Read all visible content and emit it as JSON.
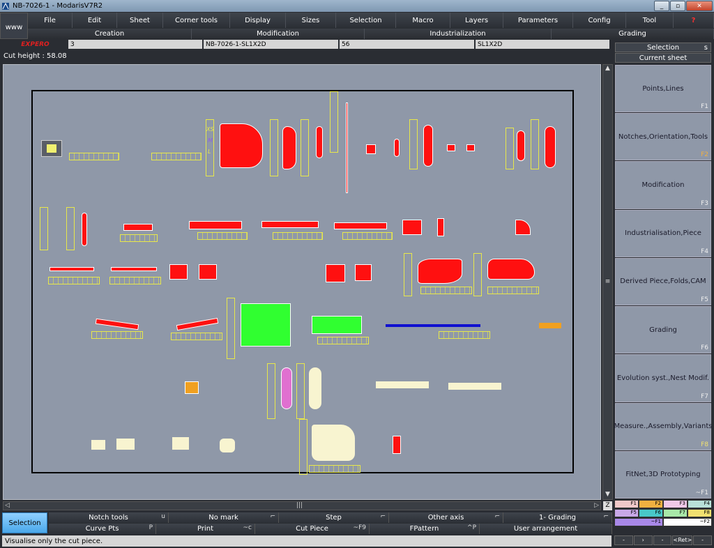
{
  "window": {
    "title": "NB-7026-1  - ModarisV7R2",
    "buttons": [
      "_",
      "▫",
      "✕"
    ]
  },
  "www": "www",
  "menu": [
    "File",
    "Edit",
    "Sheet",
    "Corner tools",
    "Display",
    "Sizes",
    "Selection",
    "Macro",
    "Layers",
    "Parameters",
    "Config",
    "Tool",
    "?"
  ],
  "categories": [
    "Creation",
    "Modification",
    "Industrialization",
    "Grading"
  ],
  "info": {
    "logo": "EXPERO",
    "field1": "3",
    "field2": "NB-7026-1-SL1X2D",
    "field3": "56",
    "field4": "SL1X2D"
  },
  "cut_height": "Cut height : 58.08",
  "right": {
    "selection": "Selection",
    "selection_key": "s",
    "current_sheet": "Current sheet",
    "panels": [
      {
        "label": "Points,Lines",
        "key": "F1"
      },
      {
        "label": "Notches,Orientation,Tools",
        "key": "F2"
      },
      {
        "label": "Modification",
        "key": "F3"
      },
      {
        "label": "Industrialisation,Piece",
        "key": "F4"
      },
      {
        "label": "Derived Piece,Folds,CAM",
        "key": "F5"
      },
      {
        "label": "Grading",
        "key": "F6"
      },
      {
        "label": "Evolution syst.,Nest Modif.",
        "key": "F7"
      },
      {
        "label": "Measure.,Assembly,Variants",
        "key": "F8"
      },
      {
        "label": "FitNet,3D Prototyping",
        "key": "~F1"
      }
    ],
    "fkeys_row1": [
      "F1",
      "F2",
      "F3",
      "F4"
    ],
    "fkeys_row2": [
      "F5",
      "F6",
      "F7",
      "F8"
    ],
    "fkeys_row3": [
      "~F1",
      "~F2"
    ],
    "nav": [
      "-",
      "›",
      "-",
      "<Ret>",
      "-"
    ]
  },
  "colors": {
    "row1": [
      "#f0c8c8",
      "#f0b040",
      "#f0c8e8",
      "#b8e0d8"
    ],
    "row2": [
      "#c8a8e8",
      "#48c8c8",
      "#a8e8a8",
      "#f0e070"
    ]
  },
  "scroll": {
    "up": "▲",
    "down": "▼",
    "left": "◁",
    "right": "▷",
    "grip": "|||",
    "vgrip": "≡",
    "zoom": "Z"
  },
  "bottom": {
    "selection": "Selection",
    "row1": [
      {
        "label": "Notch tools",
        "key": "u"
      },
      {
        "label": "No mark",
        "key": "⌐"
      },
      {
        "label": "Step",
        "key": "⌐"
      },
      {
        "label": "Other axis",
        "key": "⌐"
      },
      {
        "label": "1- Grading",
        "key": "⌐"
      }
    ],
    "row2": [
      {
        "label": "Curve Pts",
        "key": "P"
      },
      {
        "label": "Print",
        "key": "~c"
      },
      {
        "label": "Cut Piece",
        "key": "~F9"
      },
      {
        "label": "FPattern",
        "key": "^P"
      },
      {
        "label": "User arrangement",
        "key": ""
      }
    ]
  },
  "status": "Visualise only the cut piece.",
  "size_labels": [
    "XS",
    "M",
    "L"
  ]
}
